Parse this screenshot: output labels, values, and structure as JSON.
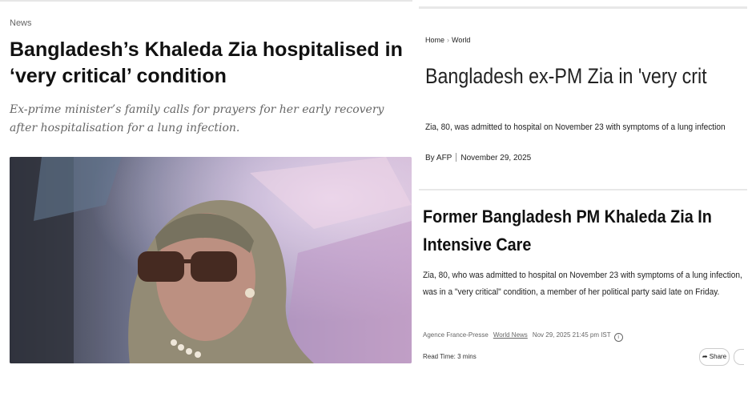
{
  "left_article": {
    "kicker": "News",
    "headline": "Bangladesh’s Khaleda Zia hospitalised in ‘very critical’ condition",
    "standfirst": "Ex-prime minister’s family calls for prayers for her early recovery after hospitalisation for a lung infection."
  },
  "right_top_article": {
    "breadcrumb": [
      "Home",
      "World"
    ],
    "headline": "Bangladesh ex-PM Zia in 'very critical' condition",
    "dek": "Zia, 80, was admitted to hospital on November 23 with symptoms of a lung infection",
    "byline_author": "By AFP",
    "byline_date": "November 29, 2025"
  },
  "right_bottom_article": {
    "headline": "Former Bangladesh PM Khaleda Zia In Intensive Care",
    "body": "Zia, 80, who was admitted to hospital on November 23 with symptoms of a lung infection, was in a \"very critical\" condition, a member of her political party said late on Friday.",
    "source": "Agence France-Presse",
    "category_link": "World News",
    "timestamp": "Nov 29, 2025 21:45 pm IST",
    "read_time": "Read Time: 3 mins",
    "share_label": "Share"
  },
  "icons": {
    "info": "info-icon",
    "share": "share-arrow-icon"
  }
}
